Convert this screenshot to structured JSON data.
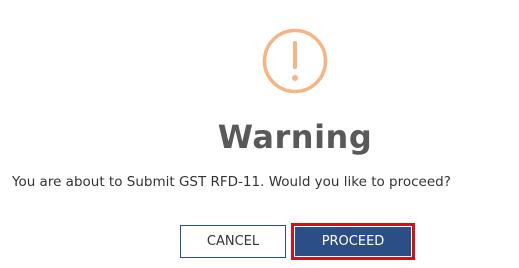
{
  "dialog": {
    "icon": "exclamation-circle-icon",
    "icon_color": "#f6b383",
    "title": "Warning",
    "message": "You are about to Submit GST RFD-11. Would you like to proceed?",
    "cancel_label": "CANCEL",
    "proceed_label": "PROCEED",
    "primary_color": "#2c4e86",
    "highlight_color": "#d0111b"
  }
}
